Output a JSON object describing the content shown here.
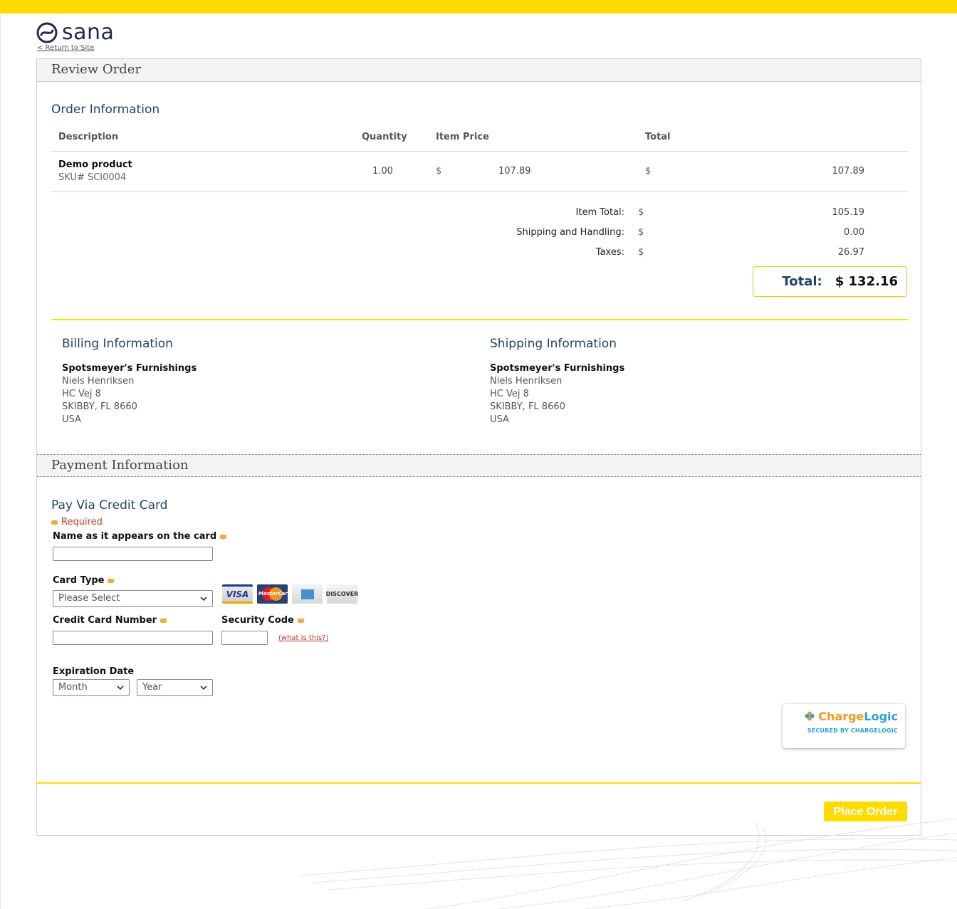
{
  "brand": {
    "name": "sana",
    "return_link": "< Return to Site"
  },
  "review": {
    "title": "Review Order",
    "order_info_title": "Order Information",
    "columns": [
      "Description",
      "Quantity",
      "Item Price",
      "Total"
    ],
    "items": [
      {
        "name": "Demo product",
        "sku": "SKU# SCI0004",
        "quantity": "1.00",
        "price_currency": "$",
        "price": "107.89",
        "total_currency": "$",
        "total": "107.89"
      }
    ],
    "summary": [
      {
        "label": "Item Total:",
        "currency": "$",
        "value": "105.19"
      },
      {
        "label": "Shipping and Handling:",
        "currency": "$",
        "value": "0.00"
      },
      {
        "label": "Taxes:",
        "currency": "$",
        "value": "26.97"
      }
    ],
    "grand_total": {
      "label": "Total:",
      "value": "$ 132.16"
    }
  },
  "billing": {
    "title": "Billing Information",
    "company": "Spotsmeyer's Furnishings",
    "lines": [
      "Niels Henriksen",
      "HC Vej 8",
      "SKIBBY, FL 8660",
      "USA"
    ]
  },
  "shipping": {
    "title": "Shipping Information",
    "company": "Spotsmeyer's Furnishings",
    "lines": [
      "Niels Henriksen",
      "HC Vej 8",
      "SKIBBY, FL 8660",
      "USA"
    ]
  },
  "payment": {
    "title": "Payment Information",
    "subtitle": "Pay Via Credit Card",
    "required_note": "Required",
    "name_label": "Name as it appears on the card",
    "name_value": "",
    "card_type_label": "Card Type",
    "card_type_value": "Please Select",
    "card_brands": [
      "VISA",
      "MasterCard",
      "American Express",
      "DISCOVER"
    ],
    "card_number_label": "Credit Card Number",
    "card_number_value": "",
    "security_code_label": "Security Code",
    "security_code_value": "",
    "what_is_this": "(what is this?)",
    "expiration_label": "Expiration Date",
    "month_value": "Month",
    "year_value": "Year",
    "secure_badge": {
      "name_part1": "Charge",
      "name_part2": "Logic",
      "tagline": "SECURED BY CHARGELOGIC"
    },
    "place_order_label": "Place Order"
  },
  "colors": {
    "accent": "#ffdc00",
    "heading": "#224466",
    "required": "#f5a742"
  }
}
